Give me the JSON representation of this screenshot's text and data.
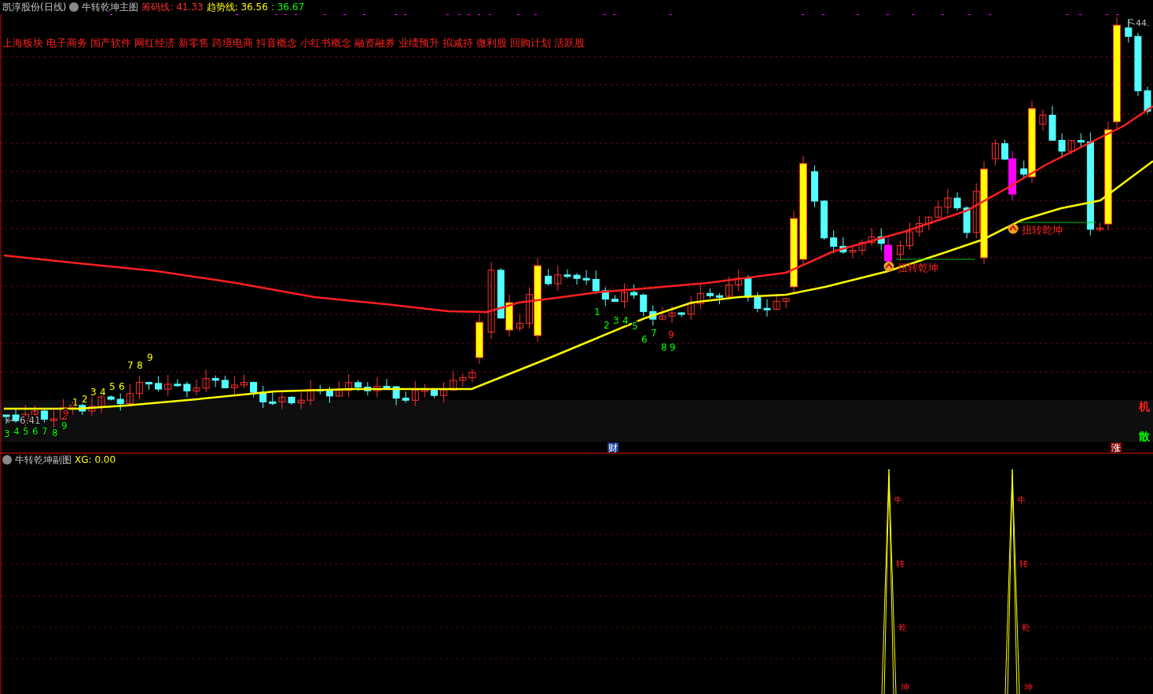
{
  "main_chart": {
    "stock": "凯淳股份(日线)",
    "indicator": "牛转乾坤主图",
    "readouts": [
      {
        "text": "筹码线: 41.33",
        "color": "#ff3232"
      },
      {
        "text": "趋势线: 36.56",
        "color": "#ffff00"
      },
      {
        "text": ": 36.67",
        "color": "#00ff00"
      }
    ],
    "sectors": [
      "上海板块",
      "电子商务",
      "国产软件",
      "网红经济",
      "新零售",
      "跨境电商",
      "抖音概念",
      "小红书概念",
      "融资融券",
      "业绩预升",
      "拟减持",
      "微利股",
      "回购计划",
      "活跃股"
    ],
    "price_label": "44.",
    "low_label": "6.41",
    "count_labels": [
      {
        "text": "1",
        "color": "#ffff00"
      },
      {
        "text": "2",
        "color": "#ffff00"
      },
      {
        "text": "3",
        "color": "#ffff00"
      },
      {
        "text": "4",
        "color": "#ffff00"
      },
      {
        "text": "5",
        "color": "#ffff00"
      },
      {
        "text": "6",
        "color": "#ffff00"
      },
      {
        "text": "7",
        "color": "#ffff00"
      },
      {
        "text": "8",
        "color": "#ffff00"
      },
      {
        "text": "9",
        "color": "#ffff00"
      },
      {
        "text": "3",
        "color": "#00ff00"
      },
      {
        "text": "4",
        "color": "#00ff00"
      },
      {
        "text": "5",
        "color": "#00ff00"
      },
      {
        "text": "6",
        "color": "#00ff00"
      },
      {
        "text": "7",
        "color": "#00ff00"
      },
      {
        "text": "8",
        "color": "#00ff00"
      },
      {
        "text": "9",
        "color": "#00ff00"
      },
      {
        "text": "9",
        "color": "#ff2020"
      },
      {
        "text": "1",
        "color": "#00ff00"
      },
      {
        "text": "2",
        "color": "#00ff00"
      },
      {
        "text": "3",
        "color": "#00ff00"
      },
      {
        "text": "4",
        "color": "#00ff00"
      },
      {
        "text": "5",
        "color": "#00ff00"
      },
      {
        "text": "6",
        "color": "#00ff00"
      },
      {
        "text": "7",
        "color": "#00ff00"
      },
      {
        "text": "8",
        "color": "#00ff00"
      },
      {
        "text": "9",
        "color": "#00ff00"
      },
      {
        "text": "9",
        "color": "#ff2020"
      }
    ],
    "signals": [
      {
        "text": "扭转乾坤"
      },
      {
        "text": "扭转乾坤"
      }
    ],
    "side_labels": [
      {
        "text": "机",
        "color": "#ff2020"
      },
      {
        "text": "散",
        "color": "#00ff00"
      }
    ],
    "markers": [
      {
        "text": "财",
        "color": "#1c3f9a"
      },
      {
        "text": "涨",
        "color": "#8b0a0a"
      }
    ]
  },
  "sub_chart": {
    "indicator": "牛转乾坤副图",
    "readout": "XG: 0.00",
    "spike_labels": [
      {
        "chars": [
          "牛",
          "转",
          "乾",
          "坤"
        ]
      },
      {
        "chars": [
          "牛",
          "转",
          "乾",
          "坤"
        ]
      }
    ]
  }
}
